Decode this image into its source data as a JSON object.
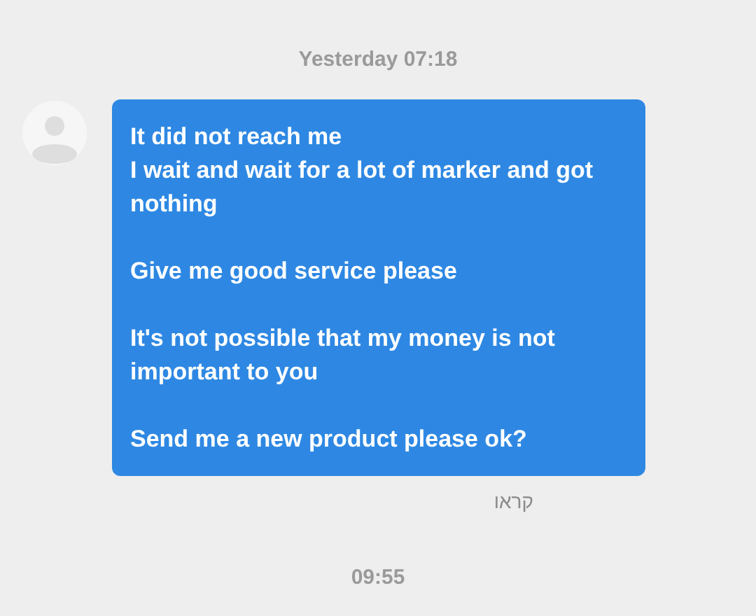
{
  "conversation": [
    {
      "kind": "timestamp",
      "text": "Yesterday 07:18"
    },
    {
      "kind": "message",
      "text": "It did not reach me\nI wait and wait for a lot of marker and got nothing\n\nGive me good service please\n\nIt's not possible that my money is not important to you\n\nSend me a new product please ok?",
      "status": "קראו"
    },
    {
      "kind": "timestamp",
      "text": "09:55"
    }
  ]
}
